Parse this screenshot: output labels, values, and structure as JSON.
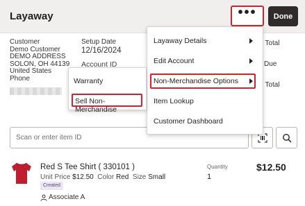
{
  "header": {
    "title": "Layaway",
    "more_label": "•••",
    "done_label": "Done"
  },
  "customer": {
    "label": "Customer",
    "name": "Demo Customer",
    "address1": "DEMO ADDRESS",
    "address2": "SOLON, OH 44139",
    "country": "United States",
    "phone_label": "Phone"
  },
  "setup": {
    "label": "Setup Date",
    "date": "12/16/2024",
    "account_id_label": "Account ID"
  },
  "summary": {
    "total_label": "t Total",
    "due_label": "Due",
    "total2_label": "t Total"
  },
  "menu": {
    "items": [
      {
        "label": "Layaway Details",
        "has_submenu": true
      },
      {
        "label": "Edit Account",
        "has_submenu": true
      },
      {
        "label": "Non-Merchandise Options",
        "has_submenu": true
      },
      {
        "label": "Item Lookup",
        "has_submenu": false
      },
      {
        "label": "Customer Dashboard",
        "has_submenu": false
      }
    ]
  },
  "submenu": {
    "items": [
      {
        "label": "Warranty"
      },
      {
        "label": "Sell Non-Merchandise"
      }
    ]
  },
  "search": {
    "placeholder": "Scan or enter item ID"
  },
  "item": {
    "name": "Red S Tee Shirt ( 330101 )",
    "unit_price_label": "Unit Price",
    "unit_price": "$12.50",
    "color_label": "Color",
    "color": "Red",
    "size_label": "Size",
    "size": "Small",
    "status": "Created",
    "associate": "Associate A",
    "quantity_label": "Quantity",
    "quantity": "1",
    "amount": "$12.50"
  },
  "colors": {
    "highlight": "#d8202a",
    "done_button": "#2e2b28",
    "header_bg": "#f1efed",
    "badge_bg": "#ece5f3"
  }
}
